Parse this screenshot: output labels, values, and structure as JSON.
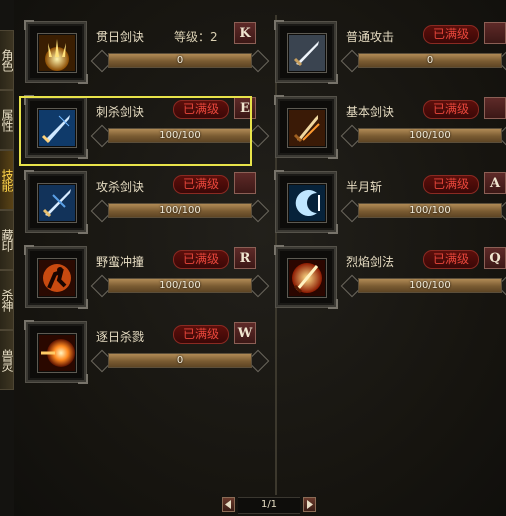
{
  "side_tabs": [
    {
      "label": "角色",
      "active": false
    },
    {
      "label": "属性",
      "active": false
    },
    {
      "label": "技能",
      "active": true
    },
    {
      "label": "藏印",
      "active": false
    },
    {
      "label": "杀神",
      "active": false
    },
    {
      "label": "兽灵",
      "active": false
    }
  ],
  "skills": [
    {
      "name": "贯日剑诀",
      "level_text": "等级：2",
      "maxed_label": "",
      "key": "K",
      "progress_text": "0",
      "progress": 0,
      "icon": "sunburst-swords-icon"
    },
    {
      "name": "刺杀剑诀",
      "level_text": "",
      "maxed_label": "已满级",
      "key": "E",
      "progress_text": "100/100",
      "progress": 1,
      "icon": "thrust-sword-icon"
    },
    {
      "name": "攻杀剑诀",
      "level_text": "",
      "maxed_label": "已满级",
      "key": "",
      "progress_text": "100/100",
      "progress": 1,
      "icon": "attack-sword-icon"
    },
    {
      "name": "野蛮冲撞",
      "level_text": "",
      "maxed_label": "已满级",
      "key": "R",
      "progress_text": "100/100",
      "progress": 1,
      "icon": "barbarian-charge-icon"
    },
    {
      "name": "逐日杀戮",
      "level_text": "",
      "maxed_label": "已满级",
      "key": "W",
      "progress_text": "0",
      "progress": 0,
      "icon": "sun-slaughter-icon"
    },
    {
      "name": "普通攻击",
      "level_text": "",
      "maxed_label": "已满级",
      "key": "",
      "progress_text": "0",
      "progress": 0,
      "icon": "basic-attack-icon"
    },
    {
      "name": "基本剑诀",
      "level_text": "",
      "maxed_label": "已满级",
      "key": "",
      "progress_text": "100/100",
      "progress": 1,
      "icon": "basic-sword-icon"
    },
    {
      "name": "半月斩",
      "level_text": "",
      "maxed_label": "已满级",
      "key": "A",
      "progress_text": "100/100",
      "progress": 1,
      "icon": "half-moon-slash-icon"
    },
    {
      "name": "烈焰剑法",
      "level_text": "",
      "maxed_label": "已满级",
      "key": "Q",
      "progress_text": "100/100",
      "progress": 1,
      "icon": "flame-sword-icon"
    }
  ],
  "pager": {
    "text": "1/1"
  },
  "colors": {
    "selection": "#e8e34a",
    "maxed": "#e8463b",
    "bar": "#9a7a4a"
  }
}
